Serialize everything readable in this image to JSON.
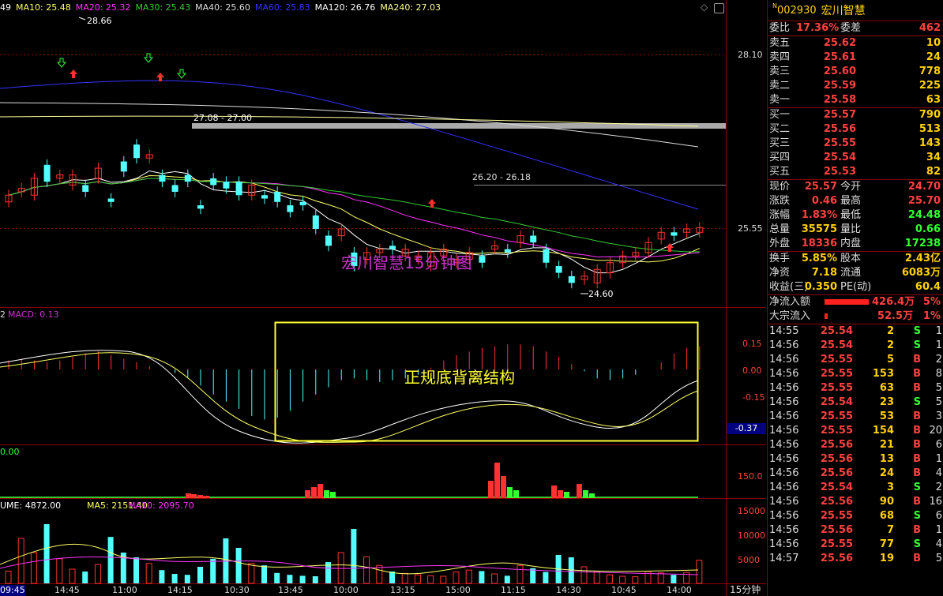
{
  "colors": {
    "up": "#ff3232",
    "down": "#54ffff",
    "ma5": "#ffffff",
    "ma10": "#ffff66",
    "ma20": "#ff33ff",
    "ma30": "#33cc33",
    "ma60": "#3333ff",
    "ma120": "#dddddd",
    "ma240": "#ffff99",
    "axis": "#8b0000",
    "label_yellow": "#ffd200",
    "purple": "#cc33cc"
  },
  "ma_legend": [
    {
      "label": "49",
      "color": "#ffffff"
    },
    {
      "label": "MA10: 25.48",
      "color": "#ffff66"
    },
    {
      "label": "MA20: 25.32",
      "color": "#ff33ff"
    },
    {
      "label": "MA30: 25.43",
      "color": "#33cc33"
    },
    {
      "label": "MA40: 25.60",
      "color": "#dddddd"
    },
    {
      "label": "MA60: 25.83",
      "color": "#3333ff"
    },
    {
      "label": "MA120: 26.76",
      "color": "#ffffff"
    },
    {
      "label": "MA240: 27.03",
      "color": "#ffff99"
    }
  ],
  "price_panel": {
    "title": "宏川智慧15分钟图",
    "label_high": "28.66",
    "label_low": "24.60",
    "band_label": "27.08 - 27.00",
    "range_label": "26.20 - 26.18",
    "price_axis": [
      "28.10",
      "25.55"
    ]
  },
  "macd_panel": {
    "title": "MACD: 0.13",
    "title_prefix": "2",
    "annotation": "正规底背离结构",
    "axis": [
      "0.15",
      "0.00",
      "-0.15",
      "-0.37"
    ]
  },
  "ind3_panel": {
    "title": "0.00",
    "axis": [
      "150.0"
    ]
  },
  "vol_panel": {
    "title": "UME: 4872.00",
    "ma5": "MA5: 2151.40",
    "ma10": "MA10: 2095.70",
    "axis": [
      "15000",
      "10000",
      "5000"
    ]
  },
  "time_axis": [
    "09:45",
    "14:45",
    "11:00",
    "14:15",
    "10:30",
    "13:45",
    "10:00",
    "13:15",
    "15:00",
    "11:15",
    "14:30",
    "10:45",
    "14:00"
  ],
  "period_label": "15分钟",
  "chart_data": {
    "type": "candlestick",
    "bars": [
      {
        "o": 25.95,
        "c": 26.05
      },
      {
        "o": 26.1,
        "c": 26.15
      },
      {
        "o": 26.05,
        "c": 26.3
      },
      {
        "o": 26.5,
        "c": 26.25
      },
      {
        "o": 26.3,
        "c": 26.35
      },
      {
        "o": 26.2,
        "c": 26.35
      },
      {
        "o": 26.2,
        "c": 26.1
      },
      {
        "o": 26.3,
        "c": 26.45
      },
      {
        "o": 26.0,
        "c": 25.95
      },
      {
        "o": 26.55,
        "c": 26.4
      },
      {
        "o": 26.8,
        "c": 26.6
      },
      {
        "o": 26.6,
        "c": 26.65
      },
      {
        "o": 26.35,
        "c": 26.25
      },
      {
        "o": 26.2,
        "c": 26.1
      },
      {
        "o": 26.35,
        "c": 26.25
      },
      {
        "o": 25.9,
        "c": 25.85
      },
      {
        "o": 26.3,
        "c": 26.2
      },
      {
        "o": 26.25,
        "c": 26.15
      },
      {
        "o": 26.25,
        "c": 26.05
      },
      {
        "o": 26.05,
        "c": 26.2
      },
      {
        "o": 26.05,
        "c": 26.0
      },
      {
        "o": 26.1,
        "c": 25.95
      },
      {
        "o": 25.9,
        "c": 25.8
      },
      {
        "o": 25.95,
        "c": 25.9
      },
      {
        "o": 25.75,
        "c": 25.55
      },
      {
        "o": 25.45,
        "c": 25.3
      },
      {
        "o": 25.45,
        "c": 25.55
      },
      {
        "o": 25.2,
        "c": 25.0
      },
      {
        "o": 25.1,
        "c": 25.2
      },
      {
        "o": 25.2,
        "c": 25.25
      },
      {
        "o": 25.3,
        "c": 25.25
      },
      {
        "o": 25.15,
        "c": 25.25
      },
      {
        "o": 25.1,
        "c": 25.15
      },
      {
        "o": 25.0,
        "c": 25.2
      },
      {
        "o": 25.15,
        "c": 25.25
      },
      {
        "o": 25.05,
        "c": 25.1
      },
      {
        "o": 25.1,
        "c": 25.2
      },
      {
        "o": 25.15,
        "c": 25.05
      },
      {
        "o": 25.25,
        "c": 25.3
      },
      {
        "o": 25.25,
        "c": 25.2
      },
      {
        "o": 25.35,
        "c": 25.45
      },
      {
        "o": 25.45,
        "c": 25.35
      },
      {
        "o": 25.25,
        "c": 25.05
      },
      {
        "o": 25.0,
        "c": 24.9
      },
      {
        "o": 24.85,
        "c": 24.75
      },
      {
        "o": 24.8,
        "c": 24.85
      },
      {
        "o": 24.75,
        "c": 24.95
      },
      {
        "o": 24.9,
        "c": 25.05
      },
      {
        "o": 25.05,
        "c": 25.15
      },
      {
        "o": 25.15,
        "c": 25.2
      },
      {
        "o": 25.2,
        "c": 25.35
      },
      {
        "o": 25.4,
        "c": 25.5
      },
      {
        "o": 25.5,
        "c": 25.45
      },
      {
        "o": 25.5,
        "c": 25.55
      },
      {
        "o": 25.5,
        "c": 25.57
      }
    ],
    "macd_hist": [
      0.05,
      0.06,
      0.05,
      0.04,
      0.05,
      0.07,
      0.09,
      0.1,
      0.08,
      0.06,
      0.04,
      0.02,
      0.0,
      -0.02,
      -0.05,
      -0.09,
      -0.14,
      -0.18,
      -0.22,
      -0.26,
      -0.28,
      -0.27,
      -0.23,
      -0.18,
      -0.14,
      -0.1,
      -0.06,
      -0.05,
      -0.06,
      -0.07,
      -0.06,
      -0.05,
      -0.03,
      0.01,
      0.05,
      0.08,
      0.1,
      0.12,
      0.13,
      0.14,
      0.14,
      0.13,
      0.1,
      0.07,
      0.03,
      -0.01,
      -0.05,
      -0.06,
      -0.05,
      -0.03,
      0.0,
      0.04,
      0.09,
      0.12,
      0.13
    ],
    "volume": [
      2600,
      9500,
      6500,
      12500,
      5200,
      3000,
      2500,
      4000,
      9800,
      6500,
      5500,
      4200,
      2800,
      2000,
      1800,
      3500,
      5200,
      9500,
      7500,
      4200,
      3800,
      2200,
      1800,
      1600,
      1500,
      4500,
      6500,
      11500,
      5600,
      3800,
      2500,
      2100,
      1800,
      1600,
      1500,
      2400,
      2800,
      2600,
      2000,
      1600,
      3800,
      3200,
      2400,
      6000,
      5500,
      3500,
      2400,
      1800,
      1500,
      1400,
      2500,
      2200,
      1800,
      2300,
      4872
    ]
  },
  "order_book": {
    "weibi_label": "委比",
    "weibi": "17.36%",
    "weicha_label": "委差",
    "weicha": "462",
    "asks": [
      {
        "label": "卖五",
        "price": "25.62",
        "vol": "10"
      },
      {
        "label": "卖四",
        "price": "25.61",
        "vol": "24"
      },
      {
        "label": "卖三",
        "price": "25.60",
        "vol": "778"
      },
      {
        "label": "卖二",
        "price": "25.59",
        "vol": "225"
      },
      {
        "label": "卖一",
        "price": "25.58",
        "vol": "63"
      }
    ],
    "bids": [
      {
        "label": "买一",
        "price": "25.57",
        "vol": "790"
      },
      {
        "label": "买二",
        "price": "25.56",
        "vol": "513"
      },
      {
        "label": "买三",
        "price": "25.55",
        "vol": "143"
      },
      {
        "label": "买四",
        "price": "25.54",
        "vol": "34"
      },
      {
        "label": "买五",
        "price": "25.53",
        "vol": "82"
      }
    ]
  },
  "stock": {
    "sup": "N",
    "code": "002930",
    "name": "宏川智慧"
  },
  "quote": [
    [
      {
        "l": "现价",
        "v": "25.57",
        "c": "#ff4040"
      },
      {
        "l": "今开",
        "v": "24.70",
        "c": "#ff4040"
      }
    ],
    [
      {
        "l": "涨跌",
        "v": "0.46",
        "c": "#ff4040"
      },
      {
        "l": "最高",
        "v": "25.70",
        "c": "#ff4040"
      }
    ],
    [
      {
        "l": "涨幅",
        "v": "1.83%",
        "c": "#ff4040"
      },
      {
        "l": "最低",
        "v": "24.48",
        "c": "#33ff33"
      }
    ],
    [
      {
        "l": "总量",
        "v": "35575",
        "c": "#ffd200"
      },
      {
        "l": "量比",
        "v": "0.66",
        "c": "#33ff33"
      }
    ],
    [
      {
        "l": "外盘",
        "v": "18336",
        "c": "#ff4040"
      },
      {
        "l": "内盘",
        "v": "17238",
        "c": "#33ff33"
      }
    ]
  ],
  "quote2": [
    [
      {
        "l": "换手",
        "v": "5.85%",
        "c": "#ffd200"
      },
      {
        "l": "股本",
        "v": "2.43亿",
        "c": "#ffd200"
      }
    ],
    [
      {
        "l": "净资",
        "v": "7.18",
        "c": "#ffd200"
      },
      {
        "l": "流通",
        "v": "6083万",
        "c": "#ffd200"
      }
    ],
    [
      {
        "l": "收益(三)",
        "v": "0.350",
        "c": "#ffd200"
      },
      {
        "l": "PE(动)",
        "v": "60.4",
        "c": "#ffd200"
      }
    ]
  ],
  "flow": [
    {
      "label": "净流入额",
      "value": "426.4万",
      "pct": "5%",
      "bar": 1.0
    },
    {
      "label": "大宗流入",
      "value": "52.5万",
      "pct": "1%",
      "bar": 0.06
    }
  ],
  "ticks": [
    {
      "t": "14:55",
      "p": "25.54",
      "v": "2",
      "d": "S",
      "n": "1"
    },
    {
      "t": "14:56",
      "p": "25.54",
      "v": "2",
      "d": "S",
      "n": "1"
    },
    {
      "t": "14:56",
      "p": "25.55",
      "v": "5",
      "d": "B",
      "n": "2"
    },
    {
      "t": "14:56",
      "p": "25.55",
      "v": "153",
      "d": "B",
      "n": "8"
    },
    {
      "t": "14:56",
      "p": "25.55",
      "v": "63",
      "d": "B",
      "n": "5"
    },
    {
      "t": "14:56",
      "p": "25.54",
      "v": "23",
      "d": "S",
      "n": "5"
    },
    {
      "t": "14:56",
      "p": "25.55",
      "v": "53",
      "d": "B",
      "n": "3"
    },
    {
      "t": "14:56",
      "p": "25.55",
      "v": "154",
      "d": "B",
      "n": "20"
    },
    {
      "t": "14:56",
      "p": "25.56",
      "v": "21",
      "d": "B",
      "n": "6"
    },
    {
      "t": "14:56",
      "p": "25.56",
      "v": "13",
      "d": "B",
      "n": "1"
    },
    {
      "t": "14:56",
      "p": "25.56",
      "v": "24",
      "d": "B",
      "n": "4"
    },
    {
      "t": "14:56",
      "p": "25.54",
      "v": "3",
      "d": "S",
      "n": "2"
    },
    {
      "t": "14:56",
      "p": "25.56",
      "v": "90",
      "d": "B",
      "n": "16"
    },
    {
      "t": "14:56",
      "p": "25.55",
      "v": "68",
      "d": "S",
      "n": "6"
    },
    {
      "t": "14:56",
      "p": "25.56",
      "v": "7",
      "d": "B",
      "n": "1"
    },
    {
      "t": "14:56",
      "p": "25.55",
      "v": "77",
      "d": "S",
      "n": "4"
    },
    {
      "t": "14:57",
      "p": "25.56",
      "v": "19",
      "d": "B",
      "n": "5"
    }
  ]
}
